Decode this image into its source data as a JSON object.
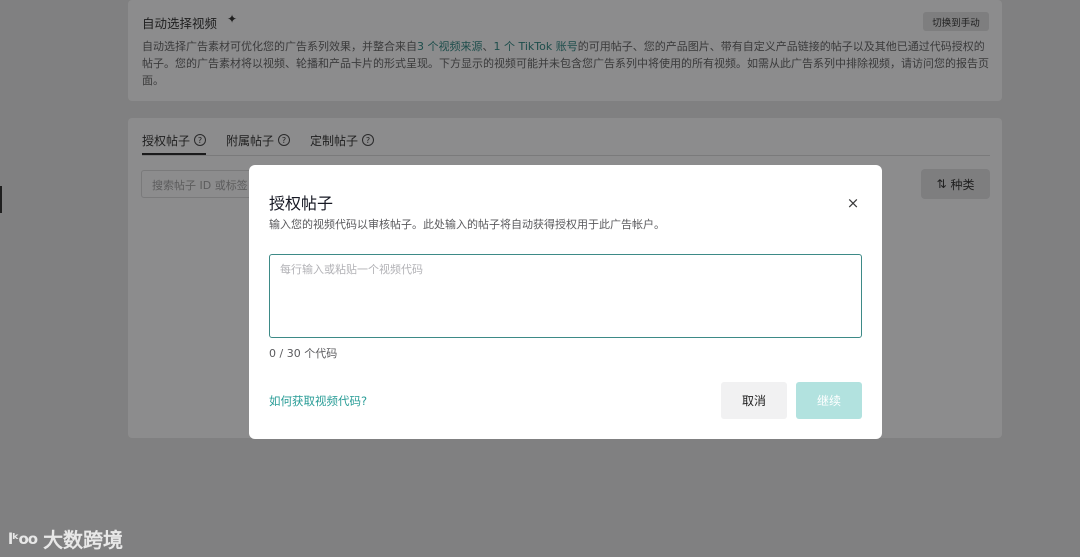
{
  "background": {
    "auto_section": {
      "title": "自动选择视频",
      "sparkle_icon": "✦",
      "switch_button": "切换到手动",
      "desc_part1": "自动选择广告素材可优化您的广告系列效果，并整合来自",
      "desc_link1": "3 个视频来源",
      "desc_sep": "、",
      "desc_link2": "1 个 TikTok 账号",
      "desc_part2": "的可用帖子、您的产品图片、带有自定义产品链接的帖子以及其他已通过代码授权的帖子。您的广告素材将以视频、轮播和产品卡片的形式呈现。下方显示的视频可能并未包含您广告系列中将使用的所有视频。如需从此广告系列中排除视频，请访问您的报告页面。"
    },
    "tabs": [
      {
        "label": "授权帖子",
        "active": true
      },
      {
        "label": "附属帖子",
        "active": false
      },
      {
        "label": "定制帖子",
        "active": false
      }
    ],
    "help_icon": "?",
    "search_placeholder": "搜索帖子 ID 或标签",
    "sort_icon": "⇅",
    "sort_label": "种类"
  },
  "modal": {
    "title": "授权帖子",
    "close_icon": "×",
    "description": "输入您的视频代码以审核帖子。此处输入的帖子将自动获得授权用于此广告帐户。",
    "textarea_placeholder": "每行输入或粘贴一个视频代码",
    "textarea_value": "",
    "counter": "0 / 30 个代码",
    "help_link": "如何获取视频代码?",
    "cancel_label": "取消",
    "continue_label": "继续"
  },
  "watermark": {
    "logo_text": "lᵏoo",
    "text": "大数跨境"
  },
  "colors": {
    "overlay": "#808081",
    "accent": "#2a9d97",
    "continue_disabled": "#b2e2df",
    "cancel_bg": "#f1f1f2"
  }
}
